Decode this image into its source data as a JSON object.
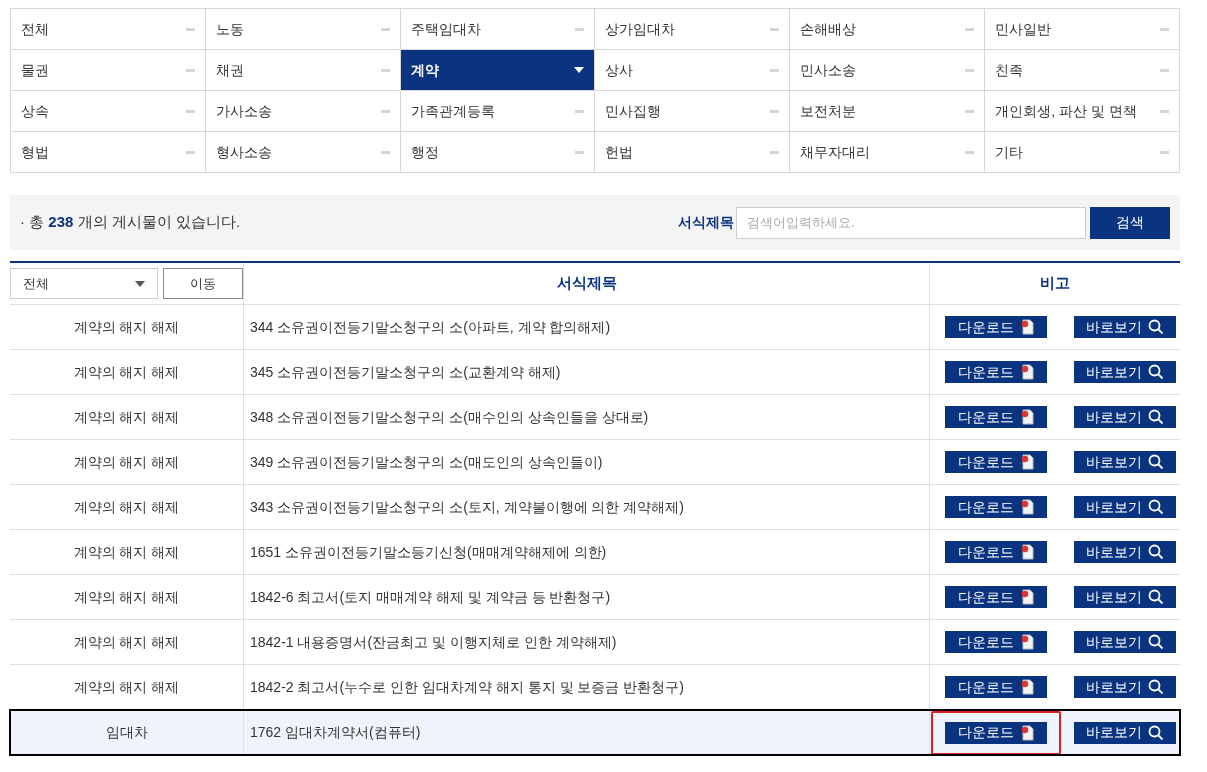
{
  "categories": [
    {
      "label": "전체",
      "selected": false
    },
    {
      "label": "노동",
      "selected": false
    },
    {
      "label": "주택임대차",
      "selected": false
    },
    {
      "label": "상가임대차",
      "selected": false
    },
    {
      "label": "손해배상",
      "selected": false
    },
    {
      "label": "민사일반",
      "selected": false
    },
    {
      "label": "물권",
      "selected": false
    },
    {
      "label": "채권",
      "selected": false
    },
    {
      "label": "계약",
      "selected": true
    },
    {
      "label": "상사",
      "selected": false
    },
    {
      "label": "민사소송",
      "selected": false
    },
    {
      "label": "친족",
      "selected": false
    },
    {
      "label": "상속",
      "selected": false
    },
    {
      "label": "가사소송",
      "selected": false
    },
    {
      "label": "가족관계등록",
      "selected": false
    },
    {
      "label": "민사집행",
      "selected": false
    },
    {
      "label": "보전처분",
      "selected": false
    },
    {
      "label": "개인회생, 파산 및 면책",
      "selected": false
    },
    {
      "label": "형법",
      "selected": false
    },
    {
      "label": "형사소송",
      "selected": false
    },
    {
      "label": "행정",
      "selected": false
    },
    {
      "label": "헌법",
      "selected": false
    },
    {
      "label": "채무자대리",
      "selected": false
    },
    {
      "label": "기타",
      "selected": false
    }
  ],
  "summary": {
    "bullet": "·",
    "prefix": "총",
    "count": "238",
    "suffix": "개의 게시물이 있습니다."
  },
  "search": {
    "label": "서식제목",
    "placeholder": "검색어입력하세요.",
    "button": "검색"
  },
  "table": {
    "filter": {
      "value": "전체",
      "button": "이동"
    },
    "columns": [
      "서식제목",
      "비고"
    ],
    "rows": [
      {
        "category": "계약의 해지 해제",
        "title": "344 소유권이전등기말소청구의 소(아파트, 계약 합의해제)",
        "download": "다운로드",
        "view": "바로보기",
        "selected": false,
        "download_marked": false
      },
      {
        "category": "계약의 해지 해제",
        "title": "345 소유권이전등기말소청구의 소(교환계약 해제)",
        "download": "다운로드",
        "view": "바로보기",
        "selected": false,
        "download_marked": false
      },
      {
        "category": "계약의 해지 해제",
        "title": "348 소유권이전등기말소청구의 소(매수인의 상속인들을 상대로)",
        "download": "다운로드",
        "view": "바로보기",
        "selected": false,
        "download_marked": false
      },
      {
        "category": "계약의 해지 해제",
        "title": "349 소유권이전등기말소청구의 소(매도인의 상속인들이)",
        "download": "다운로드",
        "view": "바로보기",
        "selected": false,
        "download_marked": false
      },
      {
        "category": "계약의 해지 해제",
        "title": "343 소유권이전등기말소청구의 소(토지, 계약불이행에 의한 계약해제)",
        "download": "다운로드",
        "view": "바로보기",
        "selected": false,
        "download_marked": false
      },
      {
        "category": "계약의 해지 해제",
        "title": "1651 소유권이전등기말소등기신청(매매계약해제에 의한)",
        "download": "다운로드",
        "view": "바로보기",
        "selected": false,
        "download_marked": false
      },
      {
        "category": "계약의 해지 해제",
        "title": "1842-6 최고서(토지 매매계약 해제 및 계약금 등 반환청구)",
        "download": "다운로드",
        "view": "바로보기",
        "selected": false,
        "download_marked": false
      },
      {
        "category": "계약의 해지 해제",
        "title": "1842-1 내용증명서(잔금최고 및 이행지체로 인한 계약해제)",
        "download": "다운로드",
        "view": "바로보기",
        "selected": false,
        "download_marked": false
      },
      {
        "category": "계약의 해지 해제",
        "title": "1842-2 최고서(누수로 인한 임대차계약 해지 통지 및 보증금 반환청구)",
        "download": "다운로드",
        "view": "바로보기",
        "selected": false,
        "download_marked": false
      },
      {
        "category": "임대차",
        "title": "1762 임대차계약서(컴퓨터)",
        "download": "다운로드",
        "view": "바로보기",
        "selected": true,
        "download_marked": true
      }
    ]
  }
}
